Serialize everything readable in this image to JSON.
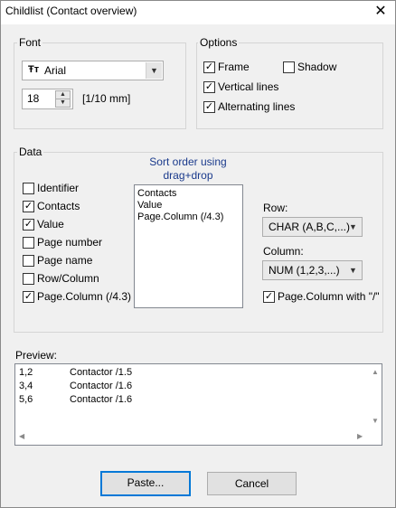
{
  "window": {
    "title": "Childlist (Contact overview)",
    "close_glyph": "✕"
  },
  "font": {
    "group_label": "Font",
    "family": "Arial",
    "family_icon_glyph": "Ŧт",
    "size_value": "18",
    "size_unit": "[1/10 mm]"
  },
  "options": {
    "group_label": "Options",
    "items": [
      {
        "label": "Frame",
        "checked": true
      },
      {
        "label": "Shadow",
        "checked": false
      },
      {
        "label": "Vertical lines",
        "checked": true
      },
      {
        "label": "Alternating lines",
        "checked": true
      }
    ]
  },
  "data": {
    "group_label": "Data",
    "fields": [
      {
        "label": "Identifier",
        "checked": false
      },
      {
        "label": "Contacts",
        "checked": true
      },
      {
        "label": "Value",
        "checked": true
      },
      {
        "label": "Page number",
        "checked": false
      },
      {
        "label": "Page name",
        "checked": false
      },
      {
        "label": "Row/Column",
        "checked": false
      },
      {
        "label": "Page.Column (/4.3)",
        "checked": true
      }
    ],
    "sort_heading_line1": "Sort order using",
    "sort_heading_line2": "drag+drop",
    "sort_items": [
      "Contacts",
      "Value",
      "Page.Column (/4.3)"
    ],
    "row_label": "Row:",
    "row_value": "CHAR (A,B,C,...)",
    "column_label": "Column:",
    "column_value": "NUM (1,2,3,...)",
    "page_column_slash": {
      "label": "Page.Column with \"/\"",
      "checked": true
    }
  },
  "preview": {
    "label": "Preview:",
    "rows": [
      {
        "pos": "1,2",
        "text": "Contactor /1.5"
      },
      {
        "pos": "3,4",
        "text": "Contactor /1.6"
      },
      {
        "pos": "5,6",
        "text": "Contactor /1.6"
      }
    ]
  },
  "buttons": {
    "paste": "Paste...",
    "cancel": "Cancel"
  },
  "colors": {
    "accent": "#0078d7",
    "sort_heading": "#1a3a8c"
  }
}
